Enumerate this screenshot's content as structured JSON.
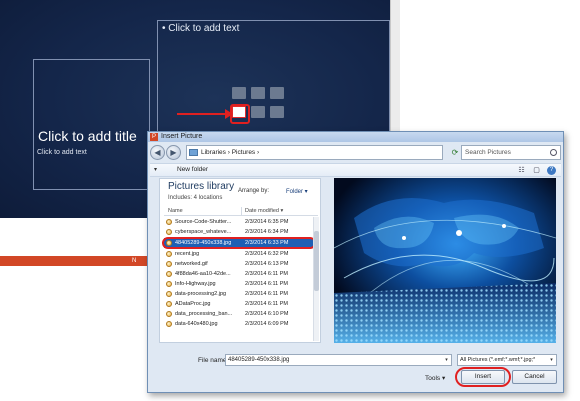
{
  "slide": {
    "content_placeholder": "• Click to add text",
    "title_placeholder": "Click to add title",
    "subtitle_placeholder": "Click to add text",
    "status_text": "N"
  },
  "dialog": {
    "title": "Insert Picture",
    "app_icon_letter": "P",
    "address_path": "Libraries › Pictures ›",
    "search_placeholder": "Search Pictures",
    "toolbar": {
      "organize_label": "▾",
      "new_folder_label": "New folder"
    },
    "library": {
      "title": "Pictures library",
      "subtitle": "Includes: 4 locations",
      "arrange_label": "Arrange by:",
      "arrange_value": "Folder ▾"
    },
    "columns": {
      "name": "Name",
      "date": "Date modified ▾"
    },
    "files": [
      {
        "name": "Source-Code-Shutter...",
        "date": "2/3/2014 6:35 PM"
      },
      {
        "name": "cyberspace_whateve...",
        "date": "2/3/2014 6:34 PM"
      },
      {
        "name": "48405289-450x338.jpg",
        "date": "2/3/2014 6:33 PM",
        "selected": true
      },
      {
        "name": "recent.jpg",
        "date": "2/3/2014 6:32 PM"
      },
      {
        "name": "networked.gif",
        "date": "2/3/2014 6:13 PM"
      },
      {
        "name": "4f88da46-aa10-42de...",
        "date": "2/3/2014 6:11 PM"
      },
      {
        "name": "Info-Highway.jpg",
        "date": "2/3/2014 6:11 PM"
      },
      {
        "name": "data-processing2.jpg",
        "date": "2/3/2014 6:11 PM"
      },
      {
        "name": "ADataProc.jpg",
        "date": "2/3/2014 6:11 PM"
      },
      {
        "name": "data_processing_ban...",
        "date": "2/3/2014 6:10 PM"
      },
      {
        "name": "data-640x480.jpg",
        "date": "2/3/2014 6:09 PM"
      }
    ],
    "filename_label": "File name:",
    "filename_value": "48405289-450x338.jpg",
    "filetype_value": "All Pictures (*.emf;*.wmf;*.jpg;*",
    "tools_label": "Tools ▾",
    "insert_label": "Insert",
    "cancel_label": "Cancel"
  },
  "colors": {
    "accent_red": "#e02020",
    "selection_blue": "#1e5fb4",
    "slide_bg": "#14264a",
    "ppt_orange": "#d24726"
  }
}
